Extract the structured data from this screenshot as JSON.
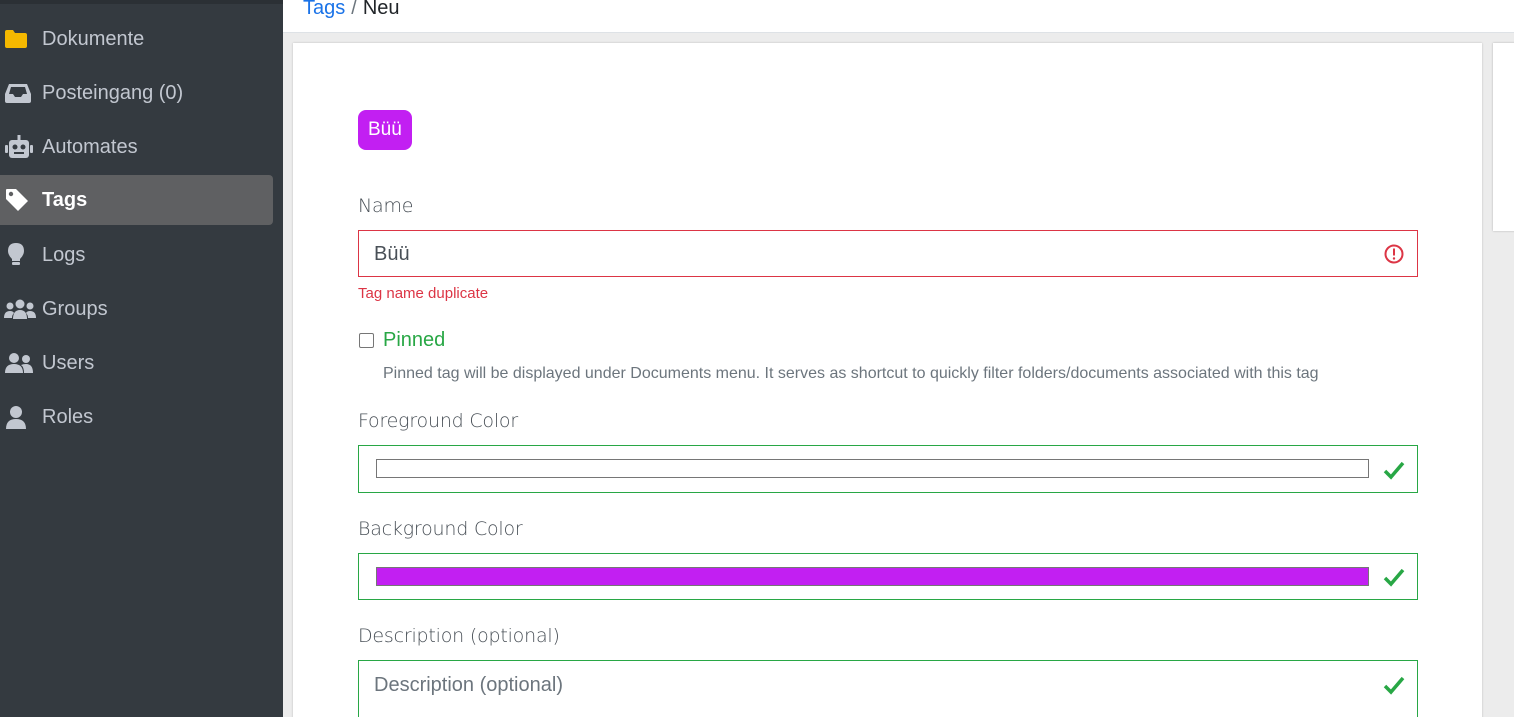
{
  "sidebar": {
    "items": [
      {
        "label": "Dokumente",
        "icon": "folder-icon",
        "color": "#f5b800"
      },
      {
        "label": "Posteingang (0)",
        "icon": "inbox-icon"
      },
      {
        "label": "Automates",
        "icon": "robot-icon"
      },
      {
        "label": "Tags",
        "icon": "tag-icon",
        "active": true
      },
      {
        "label": "Logs",
        "icon": "lightbulb-icon"
      },
      {
        "label": "Groups",
        "icon": "users-group-icon"
      },
      {
        "label": "Users",
        "icon": "user-friends-icon"
      },
      {
        "label": "Roles",
        "icon": "user-icon"
      }
    ]
  },
  "breadcrumb": {
    "link": "Tags",
    "separator": "/",
    "current": "Neu"
  },
  "form": {
    "preview": {
      "text": "Büü",
      "foreground": "#ffffff",
      "background": "#c21ff2"
    },
    "name": {
      "label": "Name",
      "value": "Büü",
      "error": "Tag name duplicate"
    },
    "pinned": {
      "label": "Pinned",
      "checked": false,
      "help": "Pinned tag will be displayed under Documents menu. It serves as shortcut to quickly filter folders/documents associated with this tag"
    },
    "foreground_color": {
      "label": "Foreground Color",
      "value": "#ffffff"
    },
    "background_color": {
      "label": "Background Color",
      "value": "#c21ff2"
    },
    "description": {
      "label": "Description (optional)",
      "placeholder": "Description (optional)"
    }
  },
  "colors": {
    "sidebar_bg": "#343a40",
    "active_bg": "#5f6062",
    "link": "#1a73e8",
    "invalid": "#dc3545",
    "valid": "#28a745"
  }
}
